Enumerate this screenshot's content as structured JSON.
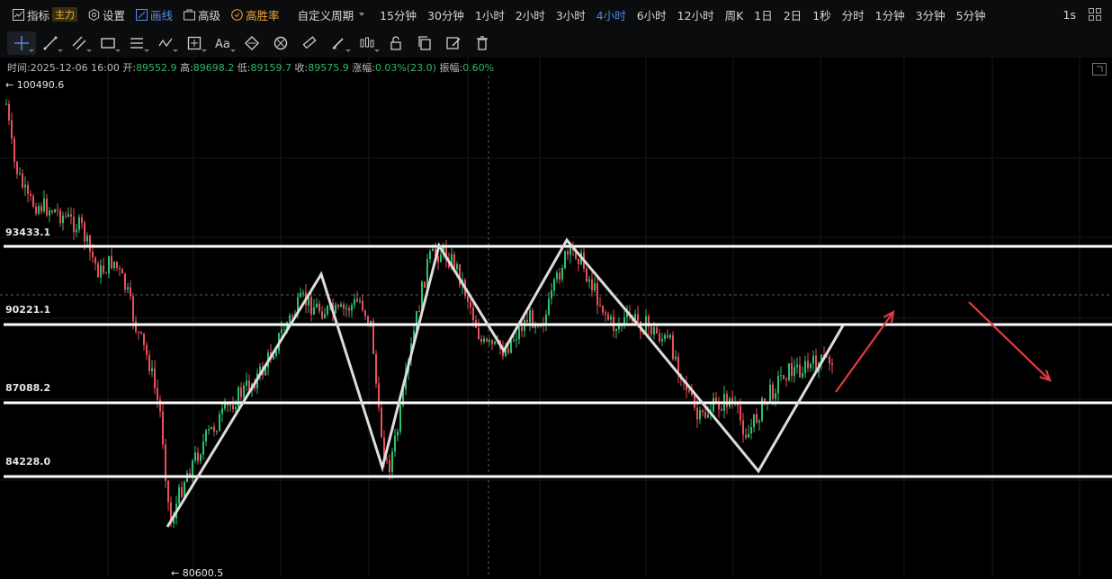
{
  "topbar": {
    "indicator": "指标",
    "indicator_badge": "主力",
    "settings": "设置",
    "draw": "画线",
    "advanced": "高级",
    "win_rate": "高胜率",
    "custom_period": "自定义周期",
    "periods": [
      "15分钟",
      "30分钟",
      "1小时",
      "2小时",
      "3小时",
      "4小时",
      "6小时",
      "12小时",
      "周K",
      "1日",
      "2日",
      "1秒",
      "分时",
      "1分钟",
      "3分钟",
      "5分钟"
    ],
    "active_period": "4小时",
    "right_period": "1s"
  },
  "ohlc": {
    "time_label": "时间:",
    "time": "2025-12-06 16:00",
    "open_label": "开:",
    "open": "89552.9",
    "high_label": "高:",
    "high": "89698.2",
    "low_label": "低:",
    "low": "89159.7",
    "close_label": "收:",
    "close": "89575.9",
    "change_label": "涨幅:",
    "change": "0.03%(23.0)",
    "amp_label": "振幅:",
    "amp": "0.60%"
  },
  "price_levels": [
    "93433.1",
    "90221.1",
    "87088.2",
    "84228.0"
  ],
  "high_mark": "← 100490.6",
  "low_mark": "← 80600.5",
  "colors": {
    "up": "#2fbf71",
    "down": "#e9505a",
    "accent": "#4f86ec",
    "arrow": "#e53a45"
  },
  "tools": [
    "crosshair-icon",
    "trendline-icon",
    "parallel-channel-icon",
    "rectangle-icon",
    "horizontal-lines-icon",
    "wave-icon",
    "measure-icon",
    "text-icon",
    "eraser-icon",
    "magnet-icon",
    "ruler-icon",
    "pen-icon",
    "candle-pattern-icon",
    "lock-icon",
    "copy-icon",
    "edit-icon",
    "trash-icon"
  ]
}
